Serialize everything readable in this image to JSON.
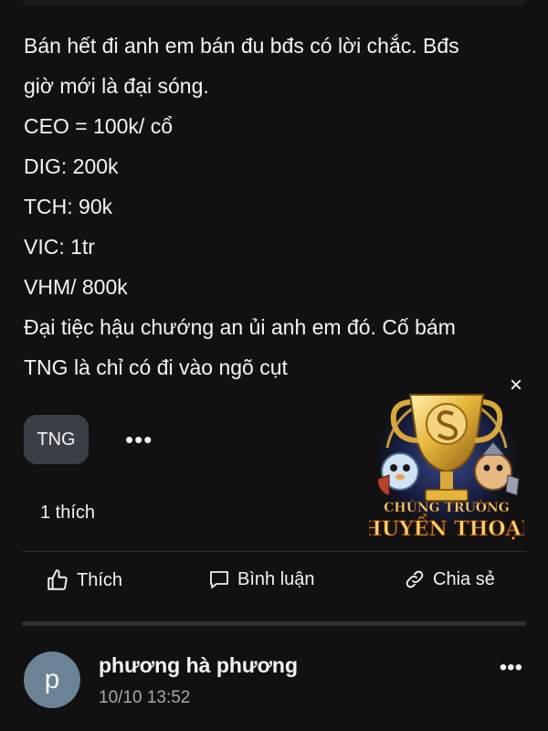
{
  "post": {
    "lines": [
      "Bán hết đi anh em bán đu bđs có lời chắc. Bđs",
      "giờ mới là đại sóng.",
      "CEO = 100k/ cổ",
      "DIG: 200k",
      "TCH: 90k",
      "VIC: 1tr",
      "VHM/ 800k",
      "Đại tiệc hậu chướng an ủi anh em đó. Cố bám",
      "TNG là chỉ có đi vào ngõ cụt"
    ],
    "tag": "TNG",
    "more_icon": "•••",
    "likes_text": "1 thích"
  },
  "actions": {
    "like_label": "Thích",
    "comment_label": "Bình luận",
    "share_label": "Chia sẻ"
  },
  "promo": {
    "close_icon": "×",
    "text_line1": "CHỨNG TRƯỜNG",
    "text_line2": "HUYỀN THOẠI"
  },
  "comment": {
    "avatar_letter": "p",
    "author": "phương hà phương",
    "time": "10/10 13:52",
    "more_icon": "•••"
  },
  "colors": {
    "background": "#111111",
    "chip": "#3a3f47",
    "avatar": "#6b8394",
    "muted": "#a8a8a8"
  }
}
